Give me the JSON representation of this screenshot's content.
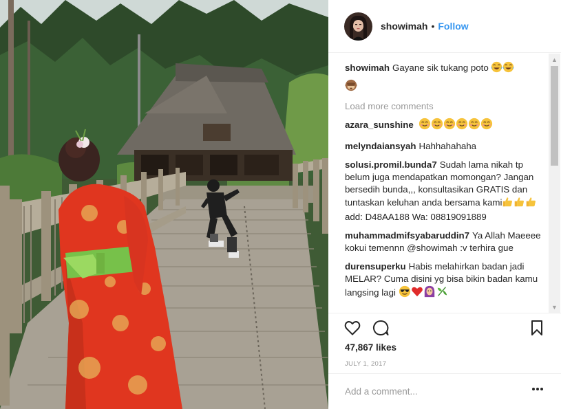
{
  "post": {
    "username": "showimah",
    "separator": "•",
    "follow_label": "Follow"
  },
  "caption": {
    "user": "showimah",
    "text": "Gayane sik tukang poto",
    "emoji": [
      "face-with-tears-of-joy",
      "face-with-tears-of-joy",
      "see-no-evil-monkey"
    ]
  },
  "load_more": "Load more comments",
  "comments": [
    {
      "user": "azara_sunshine",
      "text": "",
      "emoji": [
        "smiling-face",
        "smiling-face",
        "smiling-face",
        "smiling-face",
        "smiling-face",
        "smiling-face"
      ]
    },
    {
      "user": "melyndaiansyah",
      "text": "Hahhahahaha"
    },
    {
      "user": "solusi.promil.bunda7",
      "text": "Sudah lama nikah tp belum juga mendapatkan momongan? Jangan bersedih bunda,,, konsultasikan GRATIS dan tuntaskan keluhan anda bersama kami",
      "text_after": "add: D48AA188 Wa: 08819091889",
      "emoji": [
        "thumbs-up",
        "thumbs-up",
        "thumbs-up"
      ]
    },
    {
      "user": "muhammadmifsyabaruddin7",
      "text": "Ya Allah Maeeee kokui temennn @showimah :v terhira gue"
    },
    {
      "user": "durensuperku",
      "text": "Habis melahirkan badan jadi MELAR? Cuma disini yg bisa bikin badan kamu langsing lagi",
      "emoji": [
        "smiling-face-with-sunglasses",
        "red-heart",
        "woman-with-headscarf",
        "herb"
      ]
    }
  ],
  "actions": {
    "like_icon": "heart-icon",
    "comment_icon": "comment-icon",
    "save_icon": "bookmark-icon"
  },
  "likes_text": "47,867 likes",
  "date_text": "JULY 1, 2017",
  "add_comment_placeholder": "Add a comment...",
  "more_icon": "more-options-icon",
  "colors": {
    "follow": "#3897f0",
    "muted": "#999999",
    "text": "#262626",
    "border": "#efefef"
  }
}
